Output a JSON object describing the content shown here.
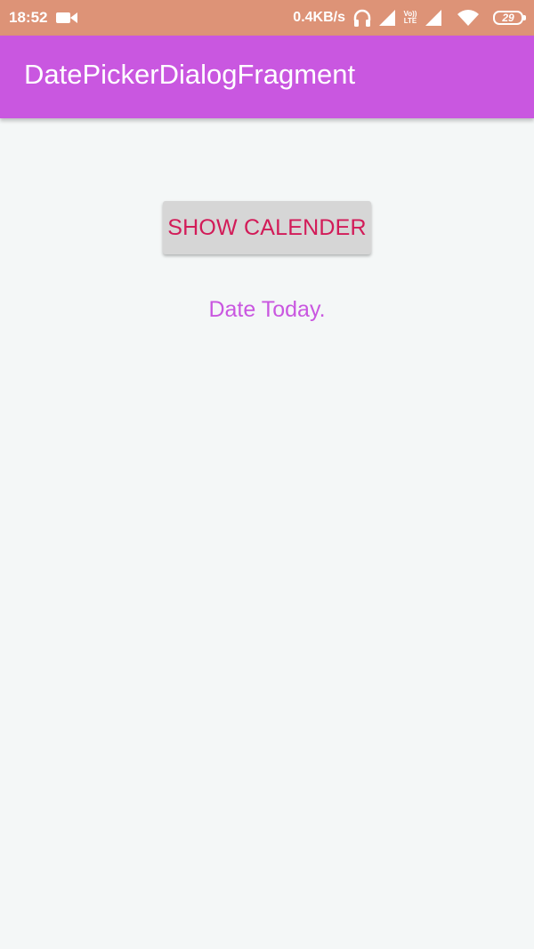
{
  "status_bar": {
    "time": "18:52",
    "net_speed": "0.4KB/s",
    "volte_top": "Vo))",
    "volte_bottom": "LTE",
    "battery": "29",
    "icons": [
      "video-camera-icon",
      "headphones-icon",
      "signal-icon",
      "volte-icon",
      "signal-icon",
      "wifi-icon",
      "battery-icon"
    ]
  },
  "app_bar": {
    "title": "DatePickerDialogFragment",
    "color": "#c957e0"
  },
  "main": {
    "show_button_label": "SHOW CALENDER",
    "date_text": "Date Today.",
    "button_text_color": "#d21b58",
    "date_text_color": "#c957e0"
  }
}
